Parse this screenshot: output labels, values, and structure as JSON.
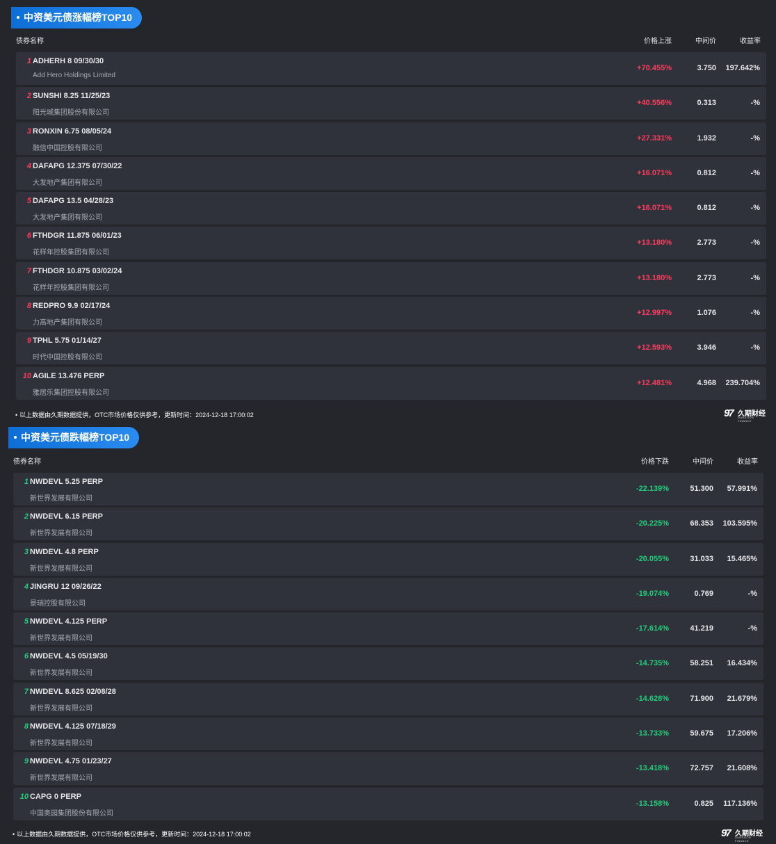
{
  "gainers": {
    "title": "中资美元债涨幅榜TOP10",
    "columns": {
      "name": "债券名称",
      "change": "价格上涨",
      "mid": "中间价",
      "yield": "收益率"
    },
    "rows": [
      {
        "rank": "1",
        "bond": "ADHERH 8 09/30/30",
        "issuer": "Add Hero Holdings Limited",
        "change": "+70.455%",
        "mid": "3.750",
        "yield": "197.642%"
      },
      {
        "rank": "2",
        "bond": "SUNSHI 8.25 11/25/23",
        "issuer": "阳光城集团股份有限公司",
        "change": "+40.556%",
        "mid": "0.313",
        "yield": "-%"
      },
      {
        "rank": "3",
        "bond": "RONXIN 6.75 08/05/24",
        "issuer": "融信中国控股有限公司",
        "change": "+27.331%",
        "mid": "1.932",
        "yield": "-%"
      },
      {
        "rank": "4",
        "bond": "DAFAPG 12.375 07/30/22",
        "issuer": "大发地产集团有限公司",
        "change": "+16.071%",
        "mid": "0.812",
        "yield": "-%"
      },
      {
        "rank": "5",
        "bond": "DAFAPG 13.5 04/28/23",
        "issuer": "大发地产集团有限公司",
        "change": "+16.071%",
        "mid": "0.812",
        "yield": "-%"
      },
      {
        "rank": "6",
        "bond": "FTHDGR 11.875 06/01/23",
        "issuer": "花样年控股集团有限公司",
        "change": "+13.180%",
        "mid": "2.773",
        "yield": "-%"
      },
      {
        "rank": "7",
        "bond": "FTHDGR 10.875 03/02/24",
        "issuer": "花样年控股集团有限公司",
        "change": "+13.180%",
        "mid": "2.773",
        "yield": "-%"
      },
      {
        "rank": "8",
        "bond": "REDPRO 9.9 02/17/24",
        "issuer": "力高地产集团有限公司",
        "change": "+12.997%",
        "mid": "1.076",
        "yield": "-%"
      },
      {
        "rank": "9",
        "bond": "TPHL 5.75 01/14/27",
        "issuer": "时代中国控股有限公司",
        "change": "+12.593%",
        "mid": "3.946",
        "yield": "-%"
      },
      {
        "rank": "10",
        "bond": "AGILE 13.476 PERP",
        "issuer": "雅居乐集团控股有限公司",
        "change": "+12.481%",
        "mid": "4.968",
        "yield": "239.704%"
      }
    ],
    "footer": "以上数据由久期数据提供，OTC市场价格仅供参考，更新时间：2024-12-18 17:00:02"
  },
  "losers": {
    "title": "中资美元债跌幅榜TOP10",
    "columns": {
      "name": "债券名称",
      "change": "价格下跌",
      "mid": "中间价",
      "yield": "收益率"
    },
    "rows": [
      {
        "rank": "1",
        "bond": "NWDEVL 5.25 PERP",
        "issuer": "新世界发展有限公司",
        "change": "-22.139%",
        "mid": "51.300",
        "yield": "57.991%"
      },
      {
        "rank": "2",
        "bond": "NWDEVL 6.15 PERP",
        "issuer": "新世界发展有限公司",
        "change": "-20.225%",
        "mid": "68.353",
        "yield": "103.595%"
      },
      {
        "rank": "3",
        "bond": "NWDEVL 4.8 PERP",
        "issuer": "新世界发展有限公司",
        "change": "-20.055%",
        "mid": "31.033",
        "yield": "15.465%"
      },
      {
        "rank": "4",
        "bond": "JINGRU 12 09/26/22",
        "issuer": "景瑞控股有限公司",
        "change": "-19.074%",
        "mid": "0.769",
        "yield": "-%"
      },
      {
        "rank": "5",
        "bond": "NWDEVL 4.125 PERP",
        "issuer": "新世界发展有限公司",
        "change": "-17.614%",
        "mid": "41.219",
        "yield": "-%"
      },
      {
        "rank": "6",
        "bond": "NWDEVL 4.5 05/19/30",
        "issuer": "新世界发展有限公司",
        "change": "-14.735%",
        "mid": "58.251",
        "yield": "16.434%"
      },
      {
        "rank": "7",
        "bond": "NWDEVL 8.625 02/08/28",
        "issuer": "新世界发展有限公司",
        "change": "-14.628%",
        "mid": "71.900",
        "yield": "21.679%"
      },
      {
        "rank": "8",
        "bond": "NWDEVL 4.125 07/18/29",
        "issuer": "新世界发展有限公司",
        "change": "-13.733%",
        "mid": "59.675",
        "yield": "17.206%"
      },
      {
        "rank": "9",
        "bond": "NWDEVL 4.75 01/23/27",
        "issuer": "新世界发展有限公司",
        "change": "-13.418%",
        "mid": "72.757",
        "yield": "21.608%"
      },
      {
        "rank": "10",
        "bond": "CAPG 0 PERP",
        "issuer": "中国奥园集团股份有限公司",
        "change": "-13.158%",
        "mid": "0.825",
        "yield": "117.136%"
      }
    ],
    "footer": "以上数据由久期数据提供，OTC市场价格仅供参考，更新时间：2024-12-18 17:00:02"
  },
  "brand": {
    "mark": "97",
    "name_cn": "久期财经",
    "name_en": "DURATION FINANCE"
  },
  "colors": {
    "up": "#ff3b5c",
    "down": "#1ed07a",
    "accent": "#1677e8",
    "row_bg": "#30323b",
    "page_bg": "#25262c"
  }
}
